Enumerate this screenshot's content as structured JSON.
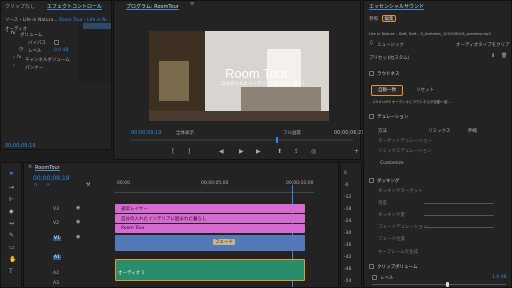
{
  "source_panel": {
    "menu_tab": "クリップなし",
    "tab_active": "エフェクトコントロール",
    "source_row_left": "ソース・Life in Natura...",
    "source_row_right": "Room Tour・Life in N...",
    "section": "オーディオ",
    "volume": "ボリューム",
    "bypass": "バイパス",
    "level_label": "レベル",
    "level_value": "0.0 dB",
    "channel_volume": "チャンネルボリューム",
    "panner": "パンナー",
    "timecode": "00;00;09;19"
  },
  "program": {
    "tab": "プログラム: RoomTour",
    "title": "Room Tour",
    "subtitle": "自分の入れたインテリアに囲まれた暮らし",
    "timecode_left": "00;00;09;19",
    "fit": "全体表示",
    "quality": "フル画質",
    "timecode_right": "00;00;06;21"
  },
  "sequence": {
    "tab": "RoomTour",
    "timecode": "00;00;09;19",
    "ruler": [
      "00;00",
      "00;00;05;00",
      "00;00;10;00"
    ],
    "tracks": [
      {
        "label": "V3"
      },
      {
        "label": "V2"
      },
      {
        "label": "V1"
      },
      {
        "label": "A1"
      },
      {
        "label": "A2"
      },
      {
        "label": "A3"
      }
    ],
    "clips": {
      "v3": "通常レイヤー",
      "v2": "自分の入れたインテリアに囲まれた暮らし",
      "v1a": "Room Tour",
      "v1b": "フェード",
      "a1": "オーディオ 1"
    },
    "meter_labels": [
      "0",
      "-6",
      "-12",
      "-18",
      "-24",
      "-30",
      "-36",
      "-42",
      "-48",
      "-54"
    ]
  },
  "essential": {
    "title": "エッセンシャルサウンド",
    "tabs": [
      "参照",
      "編集"
    ],
    "active_tab": "編集",
    "clip_name": "Life in Nature – Soft, Soft – 5_Ambient_121009016_preview.mp3",
    "type": "ミュージック",
    "type_action": "オーディオタイプをクリア",
    "preset_label": "プリセット:",
    "preset_value": "(カスタム)",
    "loudness": "ラウドネス",
    "auto_match": "自動一致",
    "reset": "リセット",
    "loudness_note": "-23.0 LUFS オーディオにラウドネスが自動一致…",
    "duration_section": "デュレーション",
    "method": "方法",
    "remix": "リミックス",
    "stretch": "伸縮",
    "target_duration": "ターゲットデュレーション",
    "remix_duration": "リミックスデュレーション",
    "customize": "Customize",
    "ducking": "ダッキング",
    "ducking_target": "ダッキングターゲット",
    "sensitivity": "感度",
    "ducking_amount": "ダッキング量",
    "fade_duration": "フェードデュレーション",
    "fade_pos": "フェード位置",
    "generate_keyframes": "キーフレームを生成",
    "clip_volume": "クリップボリューム",
    "level": "レベル",
    "level_value": "1.0 dB"
  }
}
